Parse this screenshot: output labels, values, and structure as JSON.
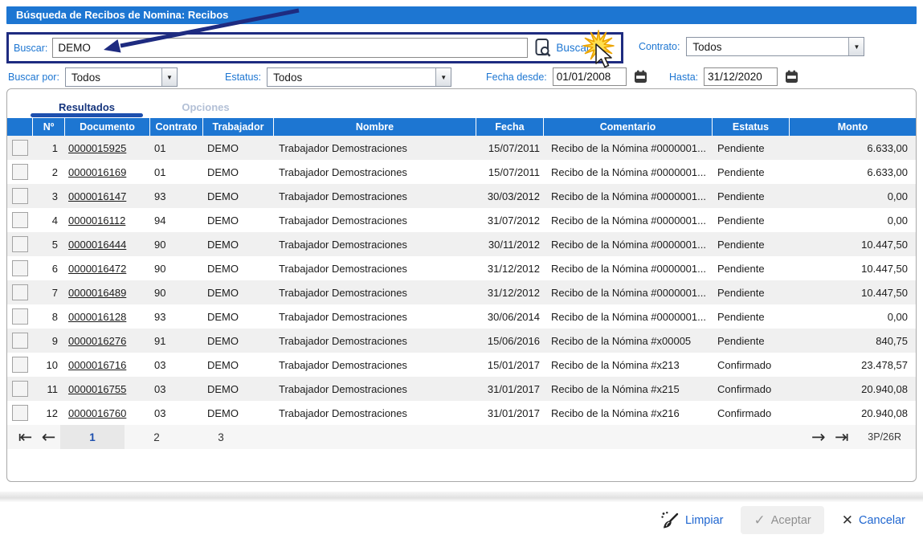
{
  "window": {
    "title": "Búsqueda de Recibos de Nomina: Recibos"
  },
  "search": {
    "label": "Buscar:",
    "value": "DEMO",
    "button_label": "Buscar"
  },
  "filters": {
    "contrato_label": "Contrato:",
    "contrato_value": "Todos",
    "buscar_por_label": "Buscar por:",
    "buscar_por_value": "Todos",
    "estatus_label": "Estatus:",
    "estatus_value": "Todos",
    "fecha_desde_label": "Fecha desde:",
    "fecha_desde_value": "01/01/2008",
    "hasta_label": "Hasta:",
    "hasta_value": "31/12/2020"
  },
  "tabs": [
    {
      "label": "Resultados",
      "active": true
    },
    {
      "label": "Opciones",
      "active": false
    }
  ],
  "table": {
    "headers": [
      "Nº",
      "Documento",
      "Contrato",
      "Trabajador",
      "Nombre",
      "Fecha",
      "Comentario",
      "Estatus",
      "Monto"
    ],
    "rows": [
      {
        "n": "1",
        "documento": "0000015925",
        "contrato": "01",
        "trabajador": "DEMO",
        "nombre": "Trabajador Demostraciones",
        "fecha": "15/07/2011",
        "comentario": "Recibo de la Nómina #0000001...",
        "estatus": "Pendiente",
        "monto": "6.633,00"
      },
      {
        "n": "2",
        "documento": "0000016169",
        "contrato": "01",
        "trabajador": "DEMO",
        "nombre": "Trabajador Demostraciones",
        "fecha": "15/07/2011",
        "comentario": "Recibo de la Nómina #0000001...",
        "estatus": "Pendiente",
        "monto": "6.633,00"
      },
      {
        "n": "3",
        "documento": "0000016147",
        "contrato": "93",
        "trabajador": "DEMO",
        "nombre": "Trabajador Demostraciones",
        "fecha": "30/03/2012",
        "comentario": "Recibo de la Nómina #0000001...",
        "estatus": "Pendiente",
        "monto": "0,00"
      },
      {
        "n": "4",
        "documento": "0000016112",
        "contrato": "94",
        "trabajador": "DEMO",
        "nombre": "Trabajador Demostraciones",
        "fecha": "31/07/2012",
        "comentario": "Recibo de la Nómina #0000001...",
        "estatus": "Pendiente",
        "monto": "0,00"
      },
      {
        "n": "5",
        "documento": "0000016444",
        "contrato": "90",
        "trabajador": "DEMO",
        "nombre": "Trabajador Demostraciones",
        "fecha": "30/11/2012",
        "comentario": "Recibo de la Nómina #0000001...",
        "estatus": "Pendiente",
        "monto": "10.447,50"
      },
      {
        "n": "6",
        "documento": "0000016472",
        "contrato": "90",
        "trabajador": "DEMO",
        "nombre": "Trabajador Demostraciones",
        "fecha": "31/12/2012",
        "comentario": "Recibo de la Nómina #0000001...",
        "estatus": "Pendiente",
        "monto": "10.447,50"
      },
      {
        "n": "7",
        "documento": "0000016489",
        "contrato": "90",
        "trabajador": "DEMO",
        "nombre": "Trabajador Demostraciones",
        "fecha": "31/12/2012",
        "comentario": "Recibo de la Nómina #0000001...",
        "estatus": "Pendiente",
        "monto": "10.447,50"
      },
      {
        "n": "8",
        "documento": "0000016128",
        "contrato": "93",
        "trabajador": "DEMO",
        "nombre": "Trabajador Demostraciones",
        "fecha": "30/06/2014",
        "comentario": "Recibo de la Nómina #0000001...",
        "estatus": "Pendiente",
        "monto": "0,00"
      },
      {
        "n": "9",
        "documento": "0000016276",
        "contrato": "91",
        "trabajador": "DEMO",
        "nombre": "Trabajador Demostraciones",
        "fecha": "15/06/2016",
        "comentario": "Recibo de la Nómina #x00005",
        "estatus": "Pendiente",
        "monto": "840,75"
      },
      {
        "n": "10",
        "documento": "0000016716",
        "contrato": "03",
        "trabajador": "DEMO",
        "nombre": "Trabajador Demostraciones",
        "fecha": "15/01/2017",
        "comentario": "Recibo de la Nómina #x213",
        "estatus": "Confirmado",
        "monto": "23.478,57"
      },
      {
        "n": "11",
        "documento": "0000016755",
        "contrato": "03",
        "trabajador": "DEMO",
        "nombre": "Trabajador Demostraciones",
        "fecha": "31/01/2017",
        "comentario": "Recibo de la Nómina #x215",
        "estatus": "Confirmado",
        "monto": "20.940,08"
      },
      {
        "n": "12",
        "documento": "0000016760",
        "contrato": "03",
        "trabajador": "DEMO",
        "nombre": "Trabajador Demostraciones",
        "fecha": "31/01/2017",
        "comentario": "Recibo de la Nómina #x216",
        "estatus": "Confirmado",
        "monto": "20.940,08"
      }
    ]
  },
  "pagination": {
    "pages": [
      "1",
      "2",
      "3"
    ],
    "active_page": "1",
    "summary": "3P/26R"
  },
  "footer": {
    "limpiar_label": "Limpiar",
    "aceptar_label": "Aceptar",
    "cancelar_label": "Cancelar"
  },
  "icons": {
    "first_page": "⇤",
    "prev_page": "←",
    "next_page": "→",
    "last_page": "⇥",
    "dropdown": "▼",
    "check": "✓",
    "close": "✕"
  },
  "colors": {
    "accent_blue": "#1d76d2",
    "annotation_navy": "#1e2b80",
    "active_tab_underline": "#1d4fae",
    "link_blue": "#1f66d0",
    "starburst_yellow": "#ffdf4d"
  }
}
